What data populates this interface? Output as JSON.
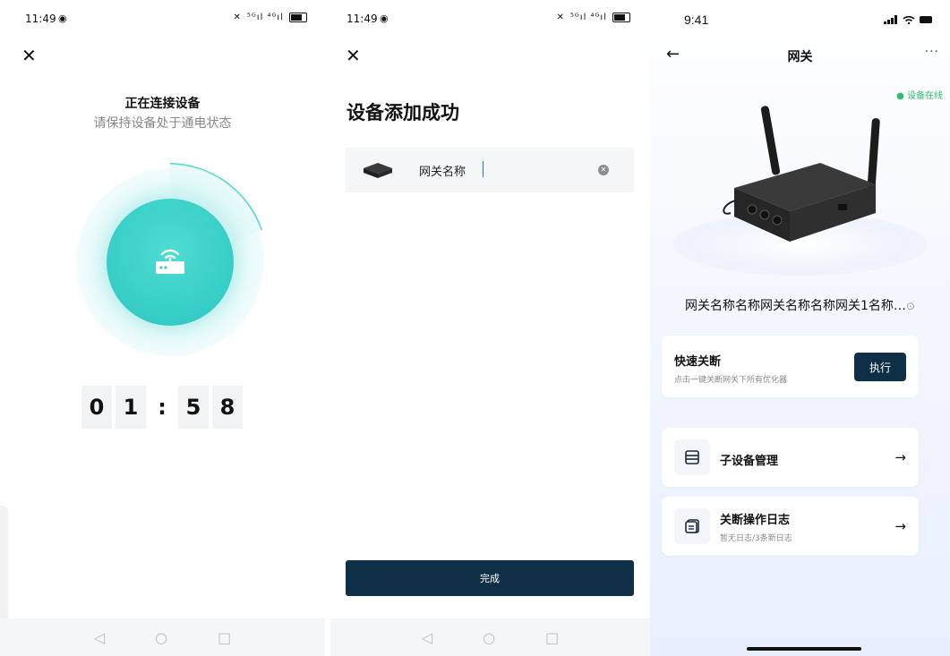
{
  "screen1": {
    "status_time": "11:49",
    "status_icons": "⁵ᴳıl ⁴ᴳıl",
    "title": "正在连接设备",
    "subtitle": "请保持设备处于通电状态",
    "timer_digits": [
      "0",
      "1",
      ":",
      "5",
      "8"
    ],
    "nav_back": "◁",
    "nav_home": "○",
    "nav_recent": "□"
  },
  "screen2": {
    "status_time": "11:49",
    "status_icons": "⁵ᴳıl ⁴ᴳıl",
    "title": "设备添加成功",
    "device_name_value": "网关名称",
    "done_label": "完成",
    "nav_back": "◁",
    "nav_home": "○",
    "nav_recent": "□"
  },
  "screen3": {
    "status_time": "9:41",
    "nav_title": "网关",
    "more": "···",
    "online_status": "● 设备在线",
    "device_name": "网关名称名称网关名称名称网关1名称…",
    "quick_off": {
      "title": "快速关断",
      "subtitle": "点击一键关断网关下所有优化器",
      "button": "执行"
    },
    "menu": [
      {
        "label": "子设备管理",
        "icon": "list-icon"
      },
      {
        "label": "关断操作日志",
        "sublabel": "暂无日志/3条新日志",
        "icon": "log-icon"
      }
    ]
  },
  "colors": {
    "accent_teal": "#35cdc6",
    "primary_dark": "#0f2f46",
    "online_green": "#2dbf6b"
  }
}
